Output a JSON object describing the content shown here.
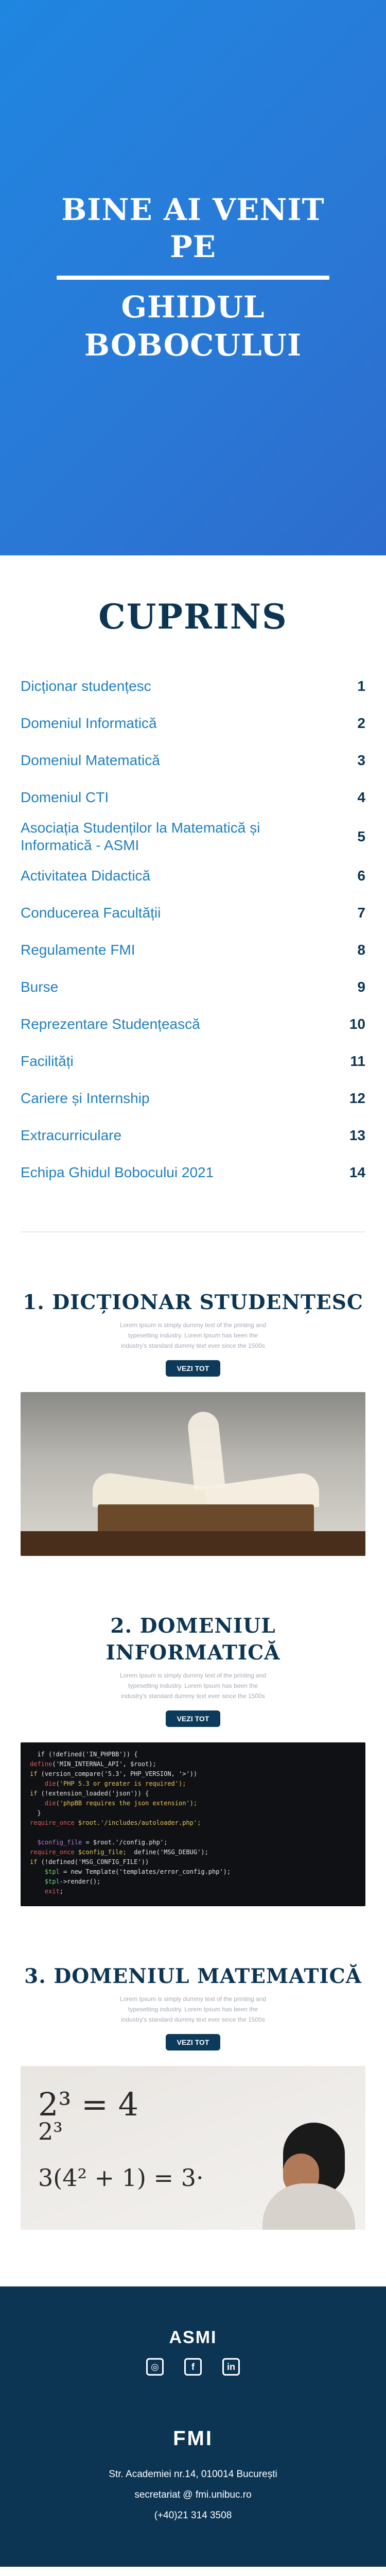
{
  "hero": {
    "line1": "BINE AI VENIT PE",
    "line2": "GHIDUL BOBOCULUI"
  },
  "toc": {
    "title": "CUPRINS",
    "items": [
      {
        "label": "Dicționar studențesc",
        "num": "1"
      },
      {
        "label": "Domeniul Informatică",
        "num": "2"
      },
      {
        "label": "Domeniul Matematică",
        "num": "3"
      },
      {
        "label": "Domeniul CTI",
        "num": "4"
      },
      {
        "label": "Asociația Studenților la Matematică și Informatică - ASMI",
        "num": "5"
      },
      {
        "label": "Activitatea Didactică",
        "num": "6"
      },
      {
        "label": "Conducerea Facultății",
        "num": "7"
      },
      {
        "label": "Regulamente FMI",
        "num": "8"
      },
      {
        "label": "Burse",
        "num": "9"
      },
      {
        "label": "Reprezentare Studențească",
        "num": "10"
      },
      {
        "label": "Facilități",
        "num": "11"
      },
      {
        "label": "Cariere și Internship",
        "num": "12"
      },
      {
        "label": "Extracurriculare",
        "num": "13"
      },
      {
        "label": "Echipa Ghidul Bobocului 2021",
        "num": "14"
      }
    ]
  },
  "sections": [
    {
      "title": "1. DICȚIONAR STUDENȚESC",
      "desc": "Lorem Ipsum is simply dummy text of the printing and typesetting industry. Lorem Ipsum has been the industry's standard dummy text ever since the 1500s",
      "button": "VEZI TOT"
    },
    {
      "title": "2. DOMENIUL INFORMATICĂ",
      "desc": "Lorem Ipsum is simply dummy text of the printing and typesetting industry. Lorem Ipsum has been the industry's standard dummy text ever since the 1500s",
      "button": "VEZI TOT"
    },
    {
      "title": "3. DOMENIUL MATEMATICĂ",
      "desc": "Lorem Ipsum is simply dummy text of the printing and typesetting industry. Lorem Ipsum has been the industry's standard dummy text ever since the 1500s",
      "button": "VEZI TOT"
    }
  ],
  "math_photo": {
    "line1": "2³ = 4",
    "line2": "2³",
    "line3": "3(4² + 1) = 3·"
  },
  "footer": {
    "title": "ASMI",
    "socials": [
      {
        "icon": "instagram-icon",
        "glyph": "◎"
      },
      {
        "icon": "facebook-icon",
        "glyph": "f"
      },
      {
        "icon": "linkedin-icon",
        "glyph": "in"
      }
    ],
    "subtitle": "FMI",
    "address": "Str. Academiei nr.14, 010014 București",
    "email": "secretariat @ fmi.unibuc.ro",
    "phone": "(+40)21 314 3508"
  },
  "colors": {
    "hero_gradient_start": "#1f86e0",
    "hero_gradient_end": "#2d6ccc",
    "navy": "#0b3553",
    "link_blue": "#1f7fbf",
    "footer_bg": "#0c3553"
  }
}
